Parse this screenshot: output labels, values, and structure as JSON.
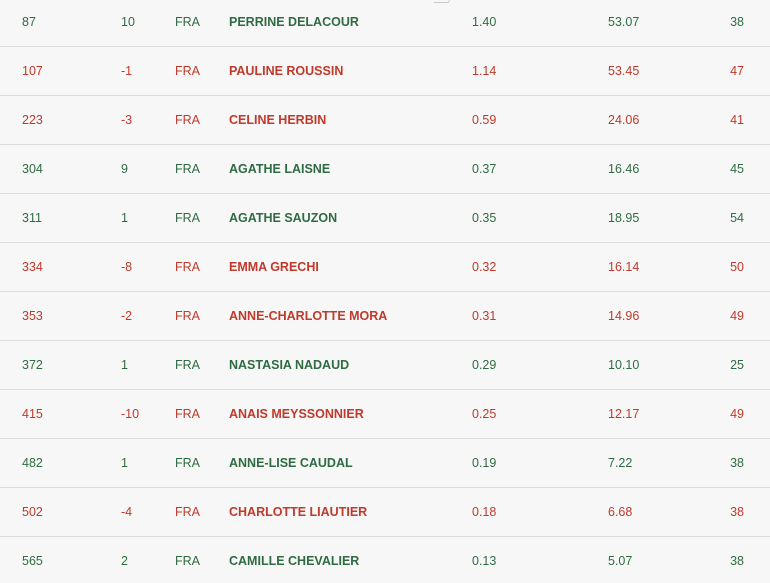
{
  "rows": [
    {
      "rank": "87",
      "move": "10",
      "nat": "FRA",
      "name": "PERRINE DELACOUR",
      "points": "1.40",
      "percent": "53.07",
      "tournaments": "38",
      "trend": "up"
    },
    {
      "rank": "107",
      "move": "-1",
      "nat": "FRA",
      "name": "PAULINE ROUSSIN",
      "points": "1.14",
      "percent": "53.45",
      "tournaments": "47",
      "trend": "down"
    },
    {
      "rank": "223",
      "move": "-3",
      "nat": "FRA",
      "name": "CELINE HERBIN",
      "points": "0.59",
      "percent": "24.06",
      "tournaments": "41",
      "trend": "down"
    },
    {
      "rank": "304",
      "move": "9",
      "nat": "FRA",
      "name": "AGATHE LAISNE",
      "points": "0.37",
      "percent": "16.46",
      "tournaments": "45",
      "trend": "up"
    },
    {
      "rank": "311",
      "move": "1",
      "nat": "FRA",
      "name": "AGATHE SAUZON",
      "points": "0.35",
      "percent": "18.95",
      "tournaments": "54",
      "trend": "up"
    },
    {
      "rank": "334",
      "move": "-8",
      "nat": "FRA",
      "name": "EMMA GRECHI",
      "points": "0.32",
      "percent": "16.14",
      "tournaments": "50",
      "trend": "down"
    },
    {
      "rank": "353",
      "move": "-2",
      "nat": "FRA",
      "name": "ANNE-CHARLOTTE MORA",
      "points": "0.31",
      "percent": "14.96",
      "tournaments": "49",
      "trend": "down"
    },
    {
      "rank": "372",
      "move": "1",
      "nat": "FRA",
      "name": "NASTASIA NADAUD",
      "points": "0.29",
      "percent": "10.10",
      "tournaments": "25",
      "trend": "up"
    },
    {
      "rank": "415",
      "move": "-10",
      "nat": "FRA",
      "name": "ANAIS MEYSSONNIER",
      "points": "0.25",
      "percent": "12.17",
      "tournaments": "49",
      "trend": "down"
    },
    {
      "rank": "482",
      "move": "1",
      "nat": "FRA",
      "name": "ANNE-LISE CAUDAL",
      "points": "0.19",
      "percent": "7.22",
      "tournaments": "38",
      "trend": "up"
    },
    {
      "rank": "502",
      "move": "-4",
      "nat": "FRA",
      "name": "CHARLOTTE LIAUTIER",
      "points": "0.18",
      "percent": "6.68",
      "tournaments": "38",
      "trend": "down"
    },
    {
      "rank": "565",
      "move": "2",
      "nat": "FRA",
      "name": "CAMILLE CHEVALIER",
      "points": "0.13",
      "percent": "5.07",
      "tournaments": "38",
      "trend": "up"
    }
  ],
  "colors": {
    "up": "#2f6b42",
    "down": "#c0392b",
    "background": "#f7f7f7",
    "divider": "#dcdcdc"
  }
}
